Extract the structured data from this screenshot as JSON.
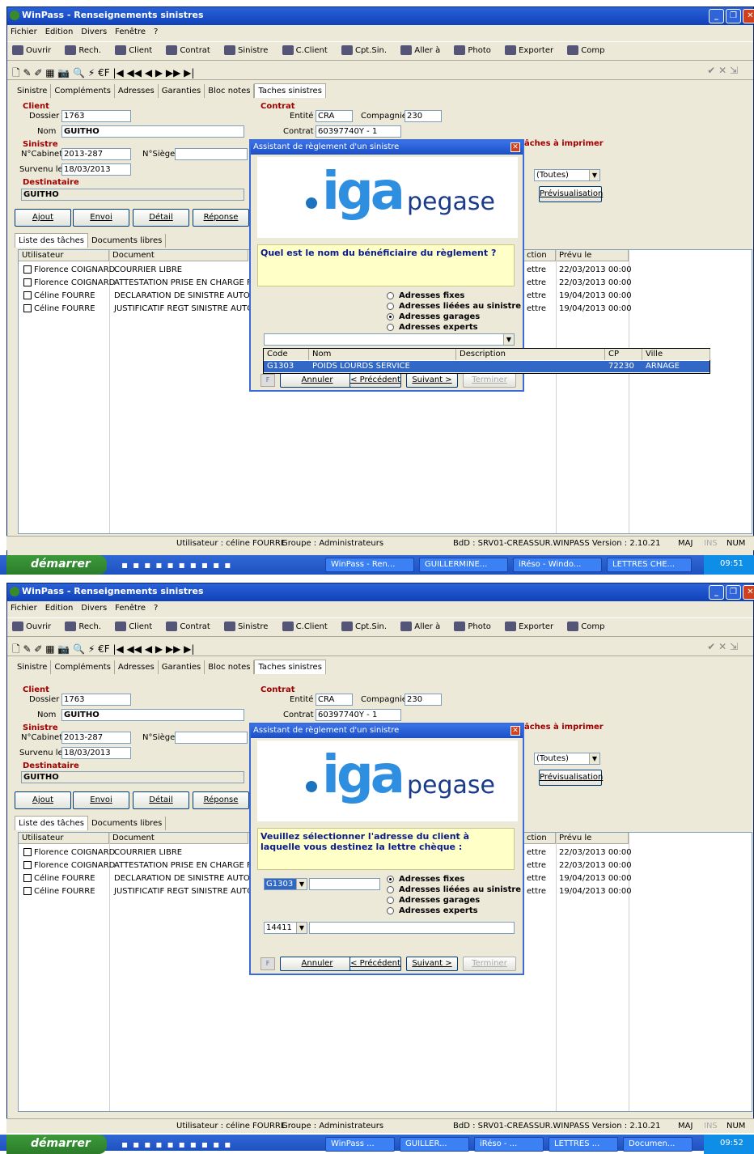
{
  "window": {
    "title": "WinPass - Renseignements sinistres"
  },
  "menu": [
    "Fichier",
    "Edition",
    "Divers",
    "Fenêtre",
    "?"
  ],
  "toolbar": [
    "Ouvrir",
    "Rech.",
    "Client",
    "Contrat",
    "Sinistre",
    "C.Client",
    "Cpt.Sin.",
    "Aller à",
    "Photo",
    "Exporter",
    "Comp"
  ],
  "nav_glyphs": "🗋 ✎ ✐  ▦ 📷  🔍 ⚡  €F  |◀ ◀◀ ◀ ▶ ▶▶ ▶|",
  "tabs": [
    "Sinistre",
    "Compléments",
    "Adresses",
    "Garanties",
    "Bloc notes",
    "Taches sinistres"
  ],
  "client": {
    "group": "Client",
    "dossier_label": "Dossier",
    "dossier": "1763",
    "nom_label": "Nom",
    "nom": "GUITHO"
  },
  "contrat": {
    "group": "Contrat",
    "entite_label": "Entité",
    "entite": "CRA",
    "compagnie_label": "Compagnie",
    "compagnie": "230",
    "contrat_label": "Contrat",
    "contrat": "60397740Y - 1"
  },
  "sinistre": {
    "group": "Sinistre",
    "ncabinet_label": "N°Cabinet",
    "ncabinet": "2013-287",
    "nsiege_label": "N°Siège",
    "survenu_label": "Survenu le",
    "survenu": "18/03/2013"
  },
  "destinataire": {
    "group": "Destinataire",
    "value": "GUITHO"
  },
  "taches_imprimer": {
    "label": "âches à imprimer",
    "filter": "(Toutes)",
    "preview": "Prévisualisation"
  },
  "buttons": {
    "ajout": "Ajout",
    "envoi": "Envoi",
    "detail": "Détail",
    "reponse": "Réponse"
  },
  "subtabs": [
    "Liste des tâches",
    "Documents libres"
  ],
  "grid": {
    "headers": [
      "Utilisateur",
      "Document",
      "ction",
      "Prévu le"
    ],
    "rows": [
      {
        "user": "Florence COIGNARD",
        "doc": "COURRIER LIBRE",
        "action": "ettre",
        "date": "22/03/2013 00:00"
      },
      {
        "user": "Florence COIGNARD",
        "doc": "ATTESTATION PRISE EN CHARGE FLO",
        "action": "ettre",
        "date": "22/03/2013 00:00"
      },
      {
        "user": "Céline FOURRE",
        "doc": "DECLARATION DE SINISTRE AUTO FL",
        "action": "ettre",
        "date": "19/04/2013 00:00"
      },
      {
        "user": "Céline FOURRE",
        "doc": "JUSTIFICATIF REGT SINISTRE AUTO",
        "action": "ettre",
        "date": "19/04/2013 00:00"
      }
    ]
  },
  "status": {
    "user": "Utilisateur : céline FOURRE",
    "group": "Groupe : Administrateurs",
    "bdd": "BdD : SRV01-CREASSUR.WINPASS Version : 2.10.21",
    "maj": "MAJ",
    "ins": "INS",
    "num": "NUM"
  },
  "taskbar": {
    "start": "démarrer",
    "items1": [
      "WinPass - Ren...",
      "GUILLERMINE...",
      "iRéso - Windo...",
      "LETTRES CHE..."
    ],
    "clock1": "09:51",
    "items2": [
      "WinPass ...",
      "GUILLER...",
      "iRéso - ...",
      "LETTRES ...",
      "Documen..."
    ],
    "clock2": "09:52"
  },
  "dialog": {
    "title": "Assistant de règlement d'un sinistre",
    "logo_iga": "iga",
    "logo_pegase": "pegase",
    "q1": "Quel est le nom du bénéficiaire du règlement ?",
    "q2": "Veuillez sélectionner l'adresse du client à laquelle vous destinez la lettre chèque :",
    "radios": [
      "Adresses fixes",
      "Adresses liéées au sinistre",
      "Adresses garages",
      "Adresses experts"
    ],
    "combo_code": "G1303",
    "combo_cp": "14411",
    "buttons": {
      "f": "F",
      "annuler": "Annuler",
      "precedent": "< Précédent",
      "suivant": "Suivant >",
      "terminer": "Terminer"
    }
  },
  "dropdown": {
    "headers": [
      "Code",
      "Nom",
      "Description",
      "CP",
      "Ville"
    ],
    "row": {
      "code": "G1303",
      "nom": "POIDS LOURDS SERVICE",
      "desc": "",
      "cp": "72230",
      "ville": "ARNAGE"
    }
  }
}
